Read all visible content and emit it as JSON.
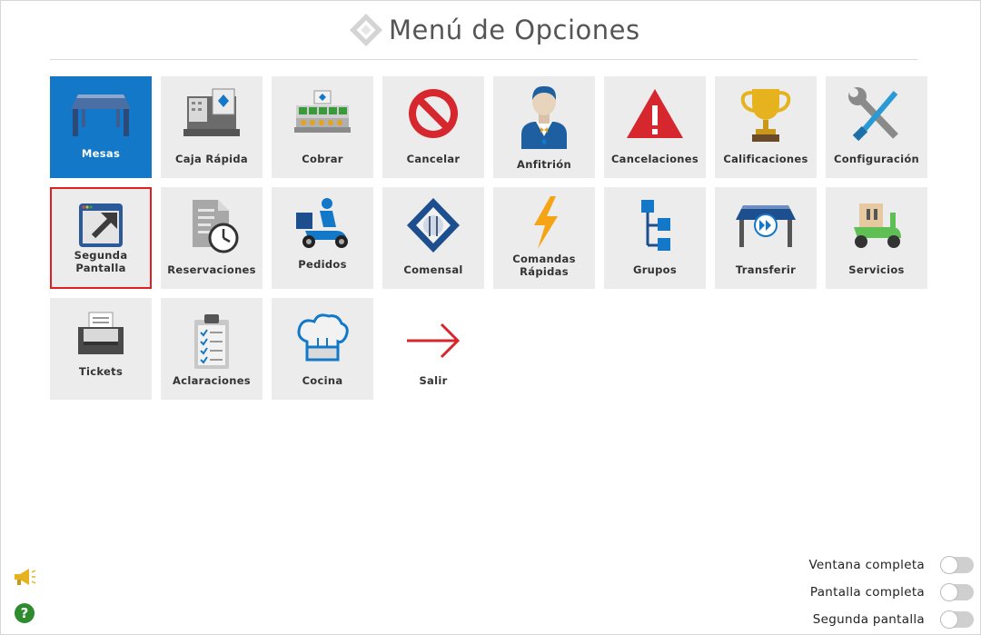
{
  "header": {
    "title": "Menú de Opciones"
  },
  "tiles": [
    {
      "label": "Mesas",
      "icon": "table-icon"
    },
    {
      "label": "Caja Rápida",
      "icon": "cash-register-icon"
    },
    {
      "label": "Cobrar",
      "icon": "cash-drawer-icon"
    },
    {
      "label": "Cancelar",
      "icon": "prohibited-icon"
    },
    {
      "label": "Anfitrión",
      "icon": "host-icon"
    },
    {
      "label": "Cancelaciones",
      "icon": "warning-icon"
    },
    {
      "label": "Calificaciones",
      "icon": "trophy-icon"
    },
    {
      "label": "Configuración",
      "icon": "tools-icon"
    },
    {
      "label": "Segunda\nPantalla",
      "icon": "external-window-icon"
    },
    {
      "label": "Reservaciones",
      "icon": "document-clock-icon"
    },
    {
      "label": "Pedidos",
      "icon": "delivery-scooter-icon"
    },
    {
      "label": "Comensal",
      "icon": "diner-icon"
    },
    {
      "label": "Comandas\nRápidas",
      "icon": "lightning-icon"
    },
    {
      "label": "Grupos",
      "icon": "hierarchy-icon"
    },
    {
      "label": "Transferir",
      "icon": "transfer-table-icon"
    },
    {
      "label": "Servicios",
      "icon": "service-scooter-icon"
    },
    {
      "label": "Tickets",
      "icon": "ticket-printer-icon"
    },
    {
      "label": "Aclaraciones",
      "icon": "clipboard-checklist-icon"
    },
    {
      "label": "Cocina",
      "icon": "chef-hat-icon"
    },
    {
      "label": "Salir",
      "icon": "arrow-right-icon"
    }
  ],
  "toggles": [
    {
      "label": "Ventana completa",
      "on": false
    },
    {
      "label": "Pantalla completa",
      "on": false
    },
    {
      "label": "Segunda pantalla",
      "on": false
    }
  ],
  "colors": {
    "active_tile": "#1478c8",
    "selected_border": "#e02020",
    "tile_bg": "#ececec"
  }
}
